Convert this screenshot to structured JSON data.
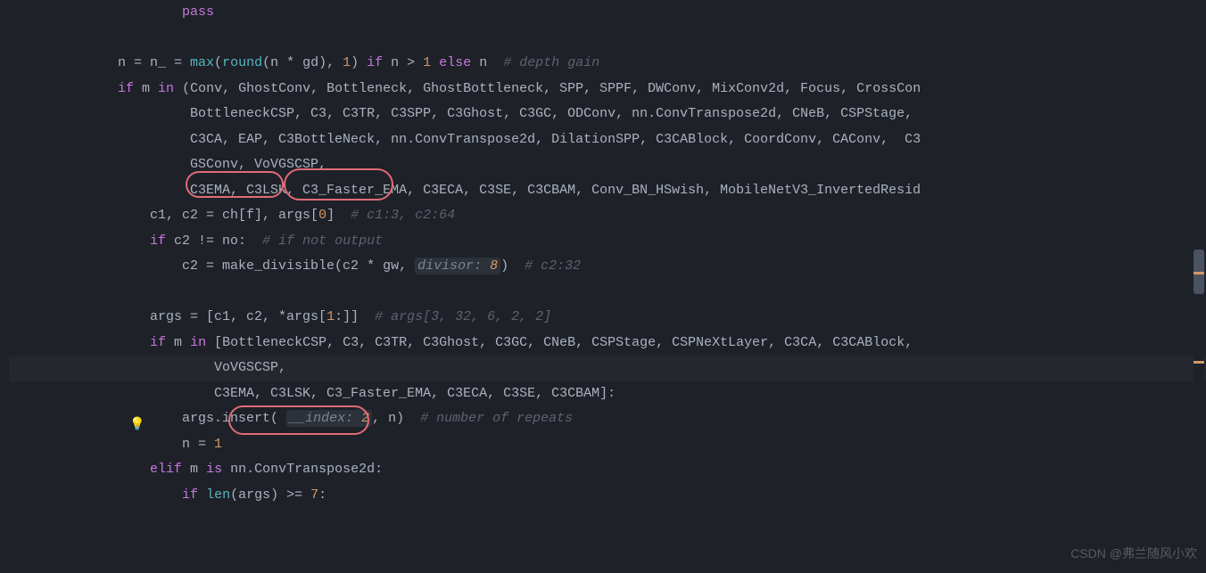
{
  "code": {
    "pass": "pass",
    "depth_gain_line": {
      "n_eq": "n = n_ = ",
      "max": "max",
      "round": "round",
      "n_star_gd": "(n * gd)",
      "comma_1": ", ",
      "one": "1",
      "if_n": ") ",
      "if": "if",
      "n_gt": " n > ",
      "else": "else",
      "n": " n  ",
      "comment": "# depth gain"
    },
    "if_m_in": "if",
    "m_in": " m ",
    "in": "in",
    "tuple_start": " (Conv, GhostConv, Bottleneck, GhostBottleneck, SPP, SPPF, DWConv, MixConv2d, Focus, CrossCon",
    "tuple_line2": "BottleneckCSP, C3, C3TR, C3SPP, C3Ghost, C3GC, ODConv, nn.ConvTranspose2d, CNeB, CSPStage, ",
    "tuple_line3": "C3CA, EAP, C3BottleNeck, nn.ConvTranspose2d, DilationSPP, C3CABlock, CoordConv, CAConv,  C3",
    "tuple_line4": "GSConv, VoVGSCSP,",
    "tuple_line5": "C3EMA, C3LSK, C3_Faster_EMA, C3ECA, C3SE, C3CBAM, Conv_BN_HSwish, MobileNetV3_InvertedResid",
    "c1_c2": "c1, c2 = ch[f], args[",
    "zero": "0",
    "c1_c2_end": "]  ",
    "c1_comment": "# c1:3, c2:64",
    "if_c2": "if",
    "c2_ne": " c2 != no:  ",
    "not_output_comment": "# if not output",
    "c2_eq": "c2 = make_divisible(c2 * gw, ",
    "divisor_hint": "divisor:",
    "eight": "8",
    "c2_end": ")  ",
    "c2_comment": "# c2:32",
    "args_eq": "args = [c1, c2, *args[",
    "one_colon": "1",
    "args_slice": ":]]  ",
    "args_comment": "# args[3, 32, 6, 2, 2]",
    "if_m_in2": "if",
    "m_in2": " m ",
    "in2": "in",
    "list_start": " [BottleneckCSP, C3, C3TR, C3Ghost, C3GC, CNeB, CSPStage, CSPNeXtLayer, C3CA, C3CABlock, ",
    "vovgscsp": "VoVGSCSP,",
    "list_line3": "C3EMA, C3LSK, C3_Faster_EMA, C3ECA, C3SE, C3CBAM]:",
    "args_insert": "args.insert( ",
    "index_hint": "__index:",
    "two": "2",
    "insert_n": ", n)  ",
    "repeats_comment": "# number of repeats",
    "n_eq_1": "n = ",
    "n_one": "1",
    "elif": "elif",
    "m_is": " m ",
    "is": "is",
    "nn_conv": " nn.ConvTranspose2d:",
    "if_len": "if",
    "len": "len",
    "args_ge": "(args) >= ",
    "seven": "7",
    "colon": ":"
  },
  "watermark": "CSDN @弗兰随风小欢"
}
